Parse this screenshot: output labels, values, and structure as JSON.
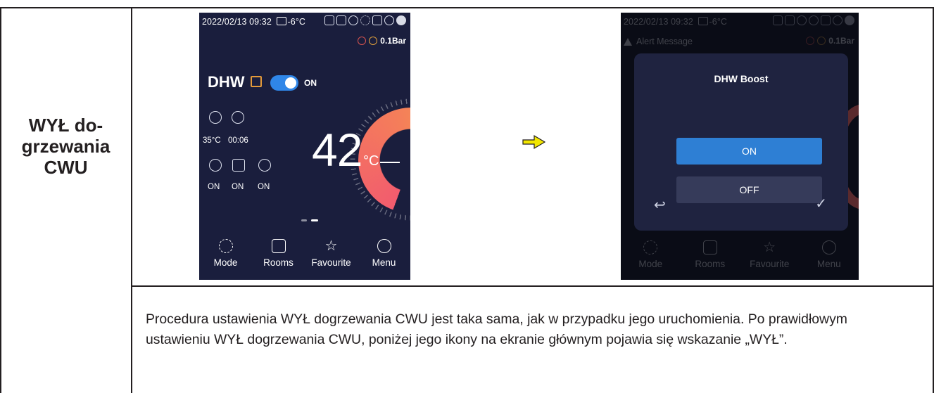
{
  "row_heading": "WYŁ do-\ngrzewania\nCWU",
  "description": "Procedura ustawienia WYŁ dogrzewania CWU jest taka sama, jak w przypadku jego uruchomienia. Po prawidłowym ustawieniu WYŁ dogrzewania CWU, poniżej jego ikony na ekranie głównym pojawia się wskazanie „WYŁ”.",
  "colors": {
    "screen_bg": "#1a1e3d",
    "toggle_on": "#2f86e8",
    "ring_start": "#f25c6e",
    "ring_end": "#f7a548",
    "arrow": "#f2e600"
  },
  "screen1": {
    "datetime": "2022/02/13 09:32",
    "outdoor_temp": "-6°C",
    "pressure": "0.1Bar",
    "title": "DHW",
    "toggle_label": "ON",
    "toggle_on": true,
    "stats": [
      {
        "icon": "gauge-icon",
        "value": "35°C"
      },
      {
        "icon": "timer-icon",
        "value": "00:06"
      }
    ],
    "modes": [
      {
        "icon": "schedule-7-24-icon",
        "value": "ON"
      },
      {
        "icon": "heater-boost-icon",
        "value": "ON"
      },
      {
        "icon": "disinfect-icon",
        "value": "ON"
      }
    ],
    "temperature": "42",
    "temperature_unit": "°C",
    "nav": [
      {
        "icon": "mode-icon",
        "label": "Mode"
      },
      {
        "icon": "rooms-icon",
        "label": "Rooms"
      },
      {
        "icon": "favourite-icon",
        "label": "Favourite"
      },
      {
        "icon": "menu-icon",
        "label": "Menu"
      }
    ]
  },
  "screen2": {
    "datetime": "2022/02/13 09:32",
    "outdoor_temp": "-6°C",
    "pressure": "0.1Bar",
    "alert": "Alert Message",
    "dialog": {
      "title": "DHW Boost",
      "on_label": "ON",
      "off_label": "OFF",
      "back_symbol": "↩",
      "confirm_symbol": "✓"
    },
    "nav": [
      {
        "label": "Mode"
      },
      {
        "label": "Rooms"
      },
      {
        "label": "Favourite"
      },
      {
        "label": "Menu"
      }
    ]
  }
}
